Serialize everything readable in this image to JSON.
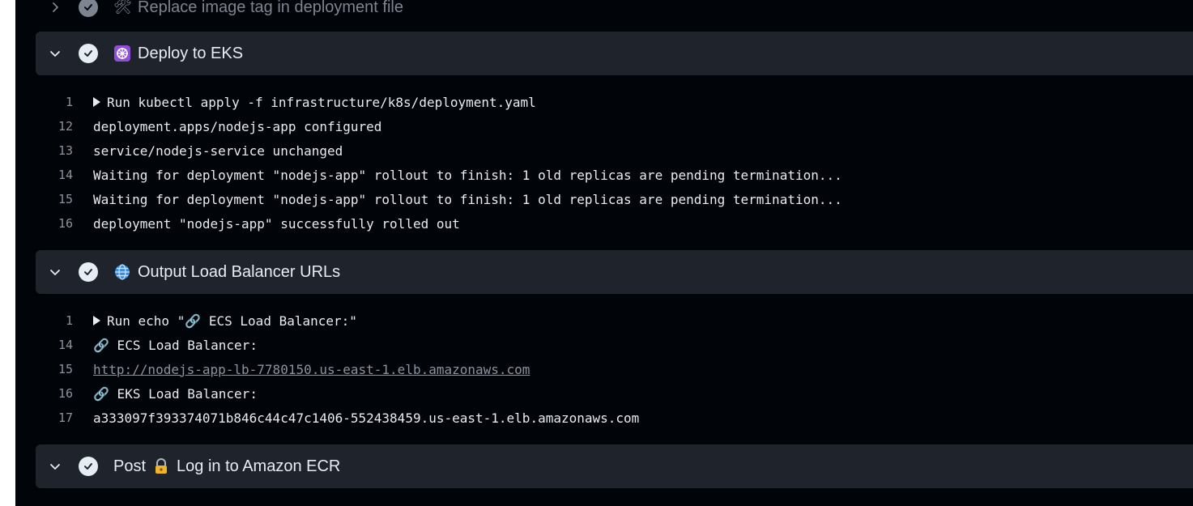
{
  "steps": [
    {
      "title": "Replace image tag in deployment file",
      "icon": "tools-icon",
      "emoji": "🛠",
      "expanded": false
    },
    {
      "title": "Deploy to EKS",
      "icon": "kubernetes-icon",
      "emoji": "☸",
      "expanded": true,
      "lines": [
        {
          "n": "1",
          "text": "Run kubectl apply -f infrastructure/k8s/deployment.yaml",
          "collapsible": true
        },
        {
          "n": "12",
          "text": "deployment.apps/nodejs-app configured"
        },
        {
          "n": "13",
          "text": "service/nodejs-service unchanged"
        },
        {
          "n": "14",
          "text": "Waiting for deployment \"nodejs-app\" rollout to finish: 1 old replicas are pending termination..."
        },
        {
          "n": "15",
          "text": "Waiting for deployment \"nodejs-app\" rollout to finish: 1 old replicas are pending termination..."
        },
        {
          "n": "16",
          "text": "deployment \"nodejs-app\" successfully rolled out"
        }
      ]
    },
    {
      "title": "Output Load Balancer URLs",
      "icon": "globe-icon",
      "emoji": "🌐",
      "expanded": true,
      "lines": [
        {
          "n": "1",
          "text": "Run echo \"🔗 ECS Load Balancer:\"",
          "collapsible": true
        },
        {
          "n": "14",
          "text": "🔗 ECS Load Balancer:"
        },
        {
          "n": "15",
          "text": "http://nodejs-app-lb-7780150.us-east-1.elb.amazonaws.com",
          "link": true
        },
        {
          "n": "16",
          "text": "🔗 EKS Load Balancer:"
        },
        {
          "n": "17",
          "text": "a333097f393374071b846c44c47c1406-552438459.us-east-1.elb.amazonaws.com"
        }
      ]
    },
    {
      "title_prefix": "Post",
      "title": "Log in to Amazon ECR",
      "icon": "lock-key-icon",
      "emoji": "🔐",
      "expanded": false
    }
  ],
  "colors": {
    "log_background": "#010409",
    "header_background": "#1f242c",
    "text": "#e6edf3",
    "muted": "#8b949e"
  }
}
